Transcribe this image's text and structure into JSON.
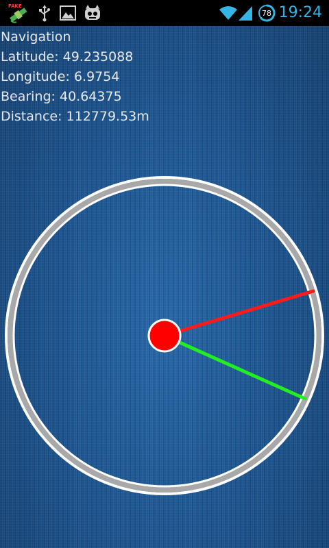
{
  "status_bar": {
    "time": "19:24",
    "battery_level": "78",
    "battery_color": "#33b5e5",
    "notification_icons": [
      "gps-fake-icon",
      "usb-icon",
      "image-icon",
      "cyanogen-icon"
    ],
    "system_icons": [
      "wifi-icon",
      "signal-icon",
      "battery-icon"
    ],
    "fake_label": "FAKE"
  },
  "navigation": {
    "title": "Navigation",
    "latitude": "Latitude: 49.235088",
    "longitude": "Longitude: 6.9754",
    "bearing": "Bearing: 40.64375",
    "distance": "Distance: 112779.53m"
  },
  "compass": {
    "ring_outer_color": "#ffffff",
    "ring_band_color": "#a8a8a8",
    "center_dot_color": "#ff0000",
    "red_needle_color": "#ff1a1a",
    "green_needle_color": "#22ee22",
    "bearing_degrees": 40.64375
  }
}
